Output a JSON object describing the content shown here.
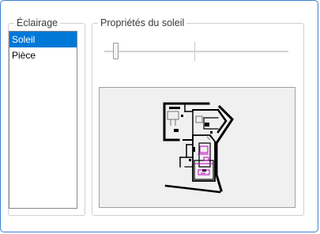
{
  "lighting": {
    "legend": "Éclairage",
    "items": [
      {
        "label": "Soleil",
        "selected": true
      },
      {
        "label": "Pièce",
        "selected": false
      }
    ]
  },
  "sun": {
    "legend": "Propriétés du soleil",
    "slider_value": 0.03
  },
  "preview": {
    "icon": "floor-plan-icon"
  }
}
